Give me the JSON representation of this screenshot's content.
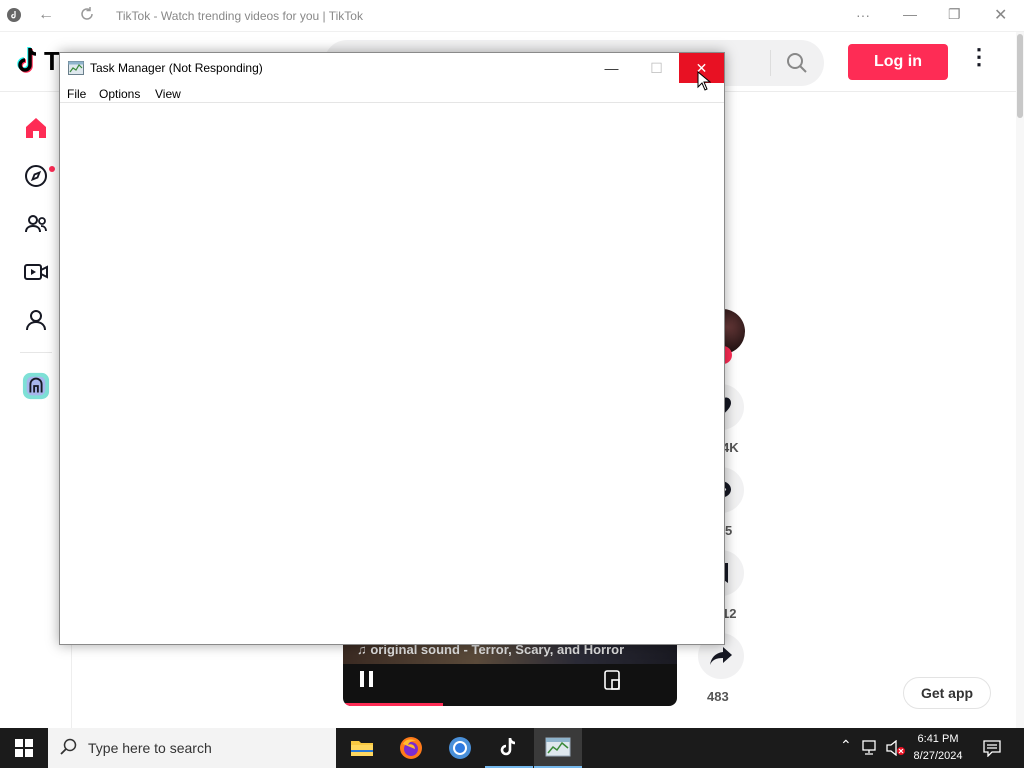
{
  "browser": {
    "title": "TikTok - Watch trending videos for you | TikTok",
    "more_label": "···"
  },
  "tiktok": {
    "logo_letter": "T",
    "login_label": "Log in",
    "brand_color": "#fe2c55",
    "video": {
      "sound_text": "♫ original sound - Terror, Scary, and Horror",
      "progress_fraction": 0.3
    },
    "actions": {
      "likes": "4K",
      "comments": "5",
      "saves": "12",
      "shares": "483"
    },
    "get_app_label": "Get app"
  },
  "task_manager": {
    "title": "Task Manager (Not Responding)",
    "menu": [
      "File",
      "Options",
      "View"
    ]
  },
  "taskbar": {
    "search_placeholder": "Type here to search",
    "time": "6:41 PM",
    "date": "8/27/2024"
  }
}
